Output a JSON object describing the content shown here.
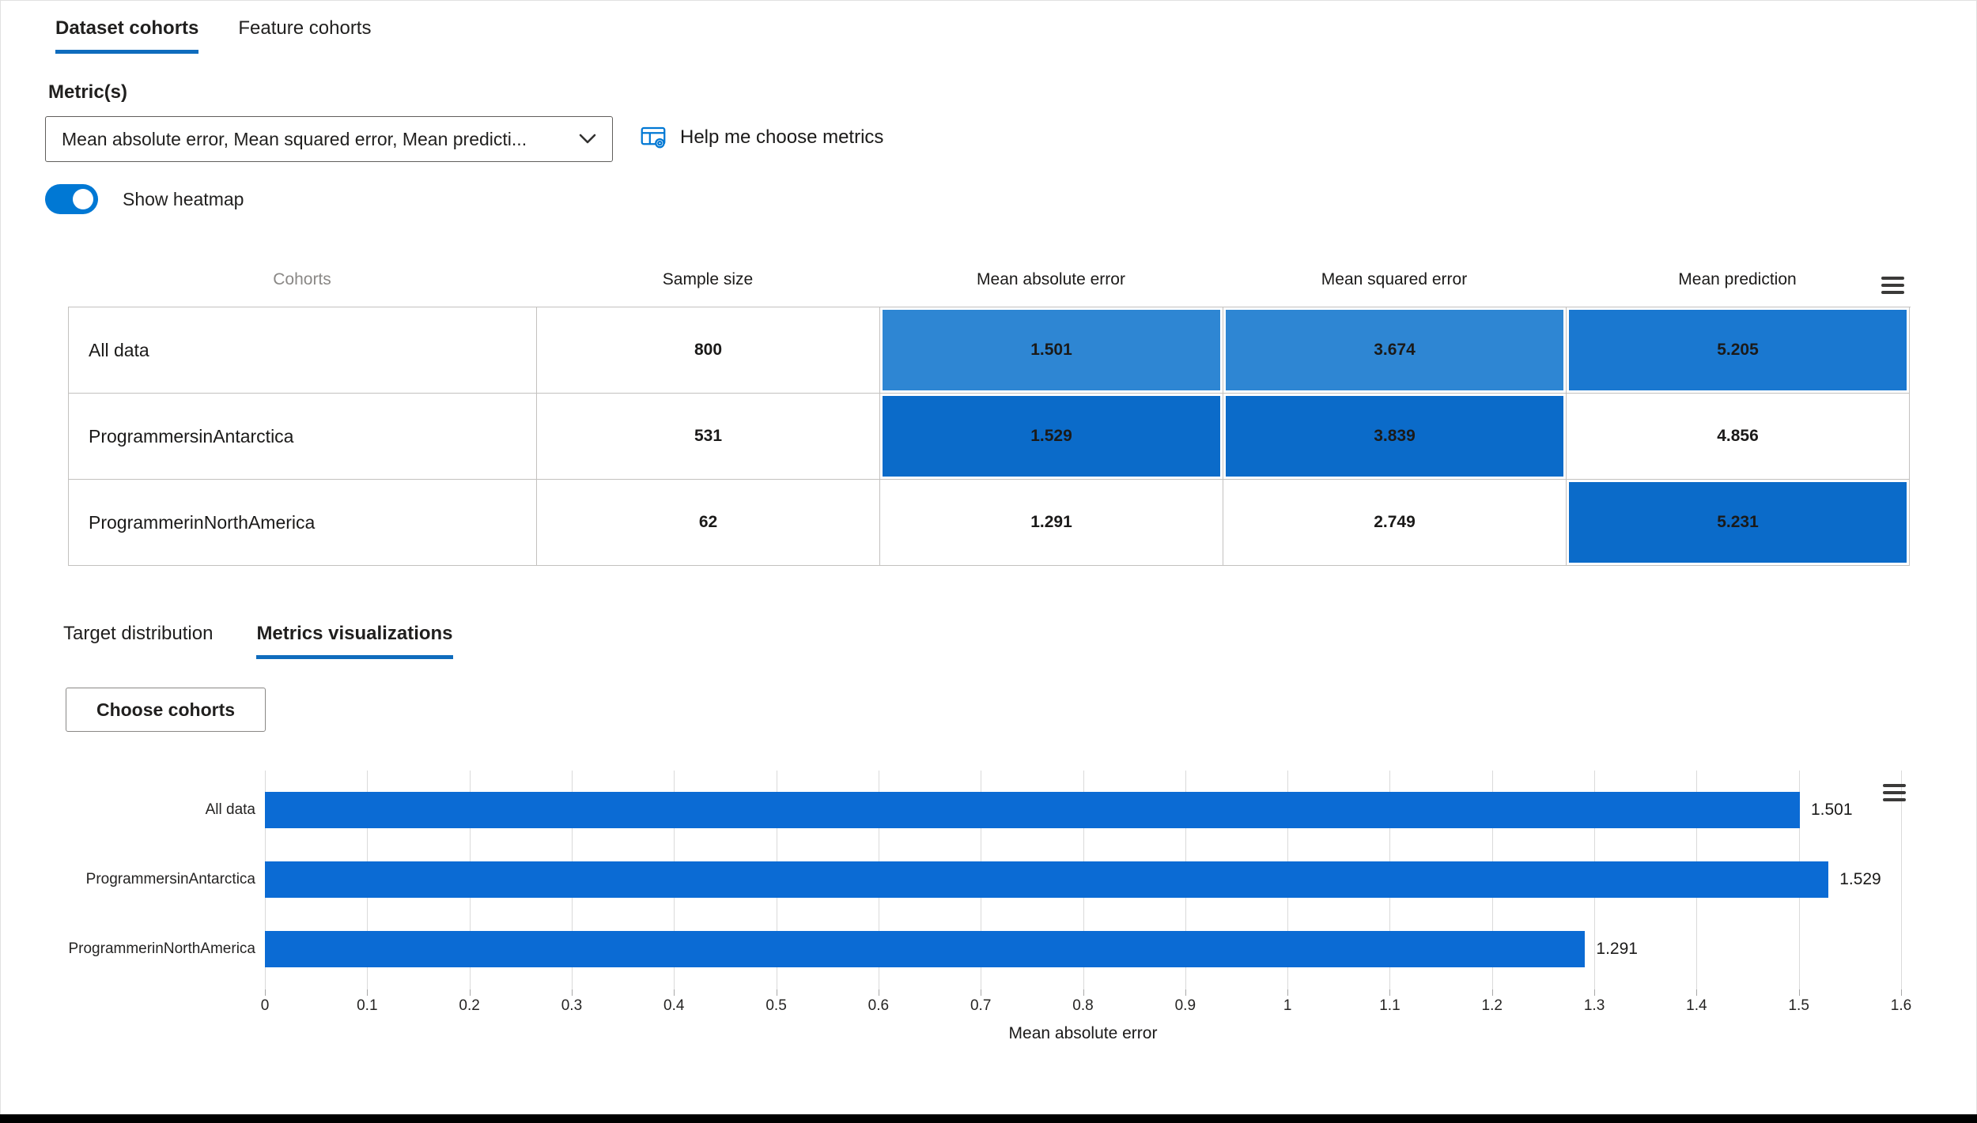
{
  "colors": {
    "accent": "#0f6cbd",
    "toggle_on": "#0078d4",
    "bar": "#0b6bd4",
    "heat_medium": "#2e86d3",
    "heat_dark": "#0b6bc9"
  },
  "top_tabs": [
    {
      "label": "Dataset cohorts",
      "active": true
    },
    {
      "label": "Feature cohorts",
      "active": false
    }
  ],
  "metric_section": {
    "label": "Metric(s)",
    "dropdown_value": "Mean absolute error, Mean squared error, Mean predicti...",
    "help_label": "Help me choose metrics"
  },
  "heatmap_toggle": {
    "label": "Show heatmap",
    "state": "on"
  },
  "cohort_table": {
    "headers": [
      "Cohorts",
      "Sample size",
      "Mean absolute error",
      "Mean squared error",
      "Mean prediction"
    ],
    "rows": [
      {
        "cohort": "All data",
        "sample_size": "800",
        "metrics": [
          {
            "value": "1.501",
            "bg": "#2e86d3"
          },
          {
            "value": "3.674",
            "bg": "#2e86d3"
          },
          {
            "value": "5.205",
            "bg": "#1a78d0"
          }
        ]
      },
      {
        "cohort": "ProgrammersinAntarctica",
        "sample_size": "531",
        "metrics": [
          {
            "value": "1.529",
            "bg": "#0b6bc9"
          },
          {
            "value": "3.839",
            "bg": "#0b6bc9"
          },
          {
            "value": "4.856",
            "bg": "#ffffff"
          }
        ]
      },
      {
        "cohort": "ProgrammerinNorthAmerica",
        "sample_size": "62",
        "metrics": [
          {
            "value": "1.291",
            "bg": "#ffffff"
          },
          {
            "value": "2.749",
            "bg": "#ffffff"
          },
          {
            "value": "5.231",
            "bg": "#0b6bc9"
          }
        ]
      }
    ]
  },
  "sub_tabs": [
    {
      "label": "Target distribution",
      "active": false
    },
    {
      "label": "Metrics visualizations",
      "active": true
    }
  ],
  "choose_cohorts_label": "Choose cohorts",
  "chart_data": {
    "type": "bar",
    "orientation": "horizontal",
    "categories": [
      "All data",
      "ProgrammersinAntarctica",
      "ProgrammerinNorthAmerica"
    ],
    "values": [
      1.501,
      1.529,
      1.291
    ],
    "value_labels": [
      "1.501",
      "1.529",
      "1.291"
    ],
    "title": "",
    "xlabel": "Mean absolute error",
    "ylabel": "",
    "xlim": [
      0,
      1.6
    ],
    "xticks": [
      0,
      0.1,
      0.2,
      0.3,
      0.4,
      0.5,
      0.6,
      0.7,
      0.8,
      0.9,
      1,
      1.1,
      1.2,
      1.3,
      1.4,
      1.5,
      1.6
    ],
    "xtick_labels": [
      "0",
      "0.1",
      "0.2",
      "0.3",
      "0.4",
      "0.5",
      "0.6",
      "0.7",
      "0.8",
      "0.9",
      "1",
      "1.1",
      "1.2",
      "1.3",
      "1.4",
      "1.5",
      "1.6"
    ],
    "grid": true,
    "legend": "none",
    "bar_color": "#0b6bd4"
  }
}
